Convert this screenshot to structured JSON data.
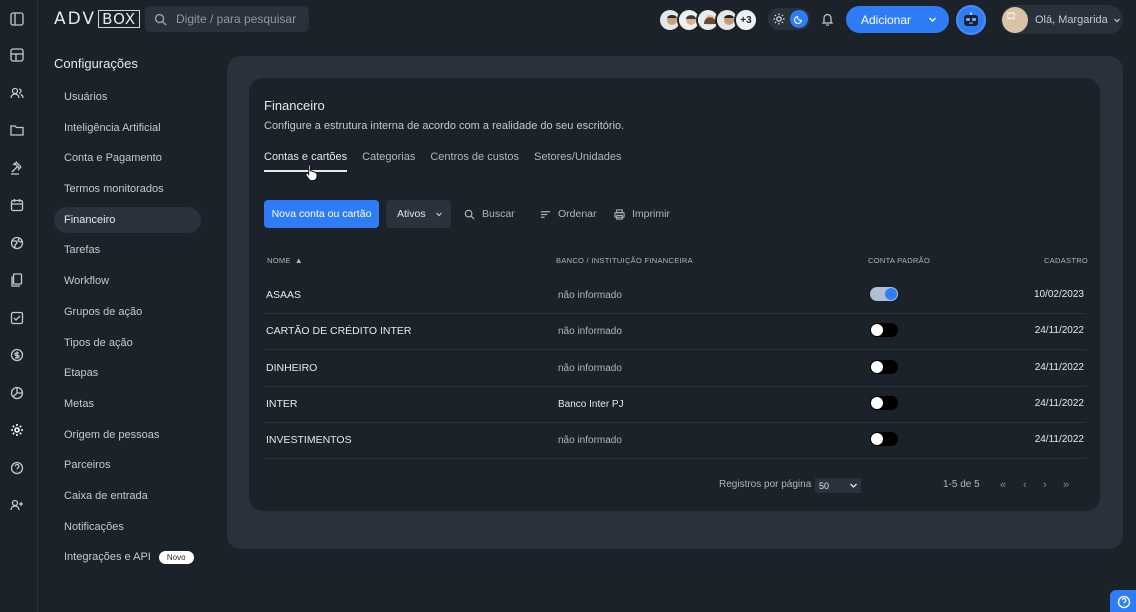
{
  "app": {
    "logo_part1": "ADV",
    "logo_part2": "BOX",
    "search_placeholder": "Digite / para pesquisar"
  },
  "header": {
    "team_more": "+3",
    "add_label": "Adicionar",
    "greeting": "Olá, Margarida",
    "accent_color": "#2f7df6"
  },
  "sidebar": {
    "title": "Configurações",
    "items": [
      {
        "label": "Usuários"
      },
      {
        "label": "Inteligência Artificial"
      },
      {
        "label": "Conta e Pagamento"
      },
      {
        "label": "Termos monitorados"
      },
      {
        "label": "Financeiro",
        "active": true
      },
      {
        "label": "Tarefas"
      },
      {
        "label": "Workflow"
      },
      {
        "label": "Grupos de ação"
      },
      {
        "label": "Tipos de ação"
      },
      {
        "label": "Etapas"
      },
      {
        "label": "Metas"
      },
      {
        "label": "Origem de pessoas"
      },
      {
        "label": "Parceiros"
      },
      {
        "label": "Caixa de entrada"
      },
      {
        "label": "Notificações"
      },
      {
        "label": "Integrações e API",
        "badge": "Novo"
      }
    ]
  },
  "rail_icons": [
    "layout-icon",
    "dashboard-icon",
    "people-icon",
    "folder-icon",
    "gavel-icon",
    "calendar-icon",
    "globe-icon",
    "documents-icon",
    "checklist-icon",
    "dollar-icon",
    "chart-pie-icon",
    "settings-icon",
    "help-icon",
    "user-plus-icon"
  ],
  "section": {
    "title": "Financeiro",
    "description": "Configure a estrutura interna de acordo com a realidade do seu escritório.",
    "tabs": [
      "Contas e cartões",
      "Categorias",
      "Centros de custos",
      "Setores/Unidades"
    ],
    "active_tab": 0
  },
  "toolbar": {
    "new_label": "Nova conta ou cartão",
    "filter_label": "Ativos",
    "search_label": "Buscar",
    "sort_label": "Ordenar",
    "print_label": "Imprimir"
  },
  "table": {
    "headers": {
      "name": "NOME",
      "bank": "BANCO / INSTITUIÇÃO FINANCEIRA",
      "default": "CONTA PADRÃO",
      "created": "CADASTRO"
    },
    "rows": [
      {
        "name": "ASAAS",
        "bank": "não informado",
        "default": true,
        "created": "10/02/2023"
      },
      {
        "name": "CARTÃO DE CRÉDITO INTER",
        "bank": "não informado",
        "default": false,
        "created": "24/11/2022"
      },
      {
        "name": "DINHEIRO",
        "bank": "não informado",
        "default": false,
        "created": "24/11/2022"
      },
      {
        "name": "INTER",
        "bank": "Banco Inter PJ",
        "default": false,
        "created": "24/11/2022"
      },
      {
        "name": "INVESTIMENTOS",
        "bank": "não informado",
        "default": false,
        "created": "24/11/2022"
      }
    ]
  },
  "pagination": {
    "per_page_label": "Registros por página",
    "per_page_value": "50",
    "range_label": "1-5 de 5"
  }
}
